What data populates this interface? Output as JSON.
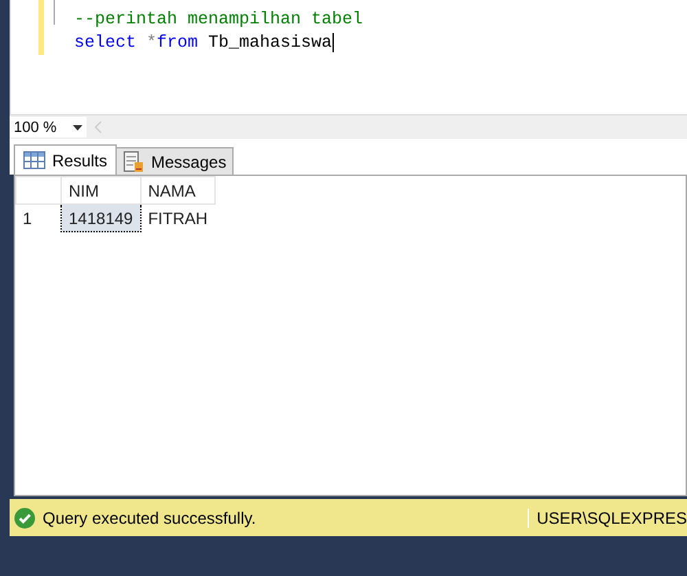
{
  "editor": {
    "lines": [
      {
        "tokens": [
          {
            "kind": "comment",
            "text": "--perintah menampilhan tabel"
          }
        ]
      },
      {
        "tokens": [
          {
            "kind": "keyword",
            "text": "select"
          },
          {
            "kind": "operator",
            "text": " *"
          },
          {
            "kind": "keyword",
            "text": "from"
          },
          {
            "kind": "plain",
            "text": " Tb_mahasiswa"
          }
        ]
      }
    ]
  },
  "zoom": {
    "value": "100 %"
  },
  "tabs": [
    {
      "label": "Results",
      "selected": true,
      "kind": "grid"
    },
    {
      "label": "Messages",
      "selected": false,
      "kind": "messages"
    }
  ],
  "table": {
    "columns": [
      "NIM",
      "NAMA"
    ],
    "rows": [
      {
        "number": "1",
        "cells": [
          "1418149",
          "FITRAH"
        ]
      }
    ]
  },
  "status_bar": {
    "message": "Query executed successfully.",
    "server": "USER\\SQLEXPRES"
  }
}
